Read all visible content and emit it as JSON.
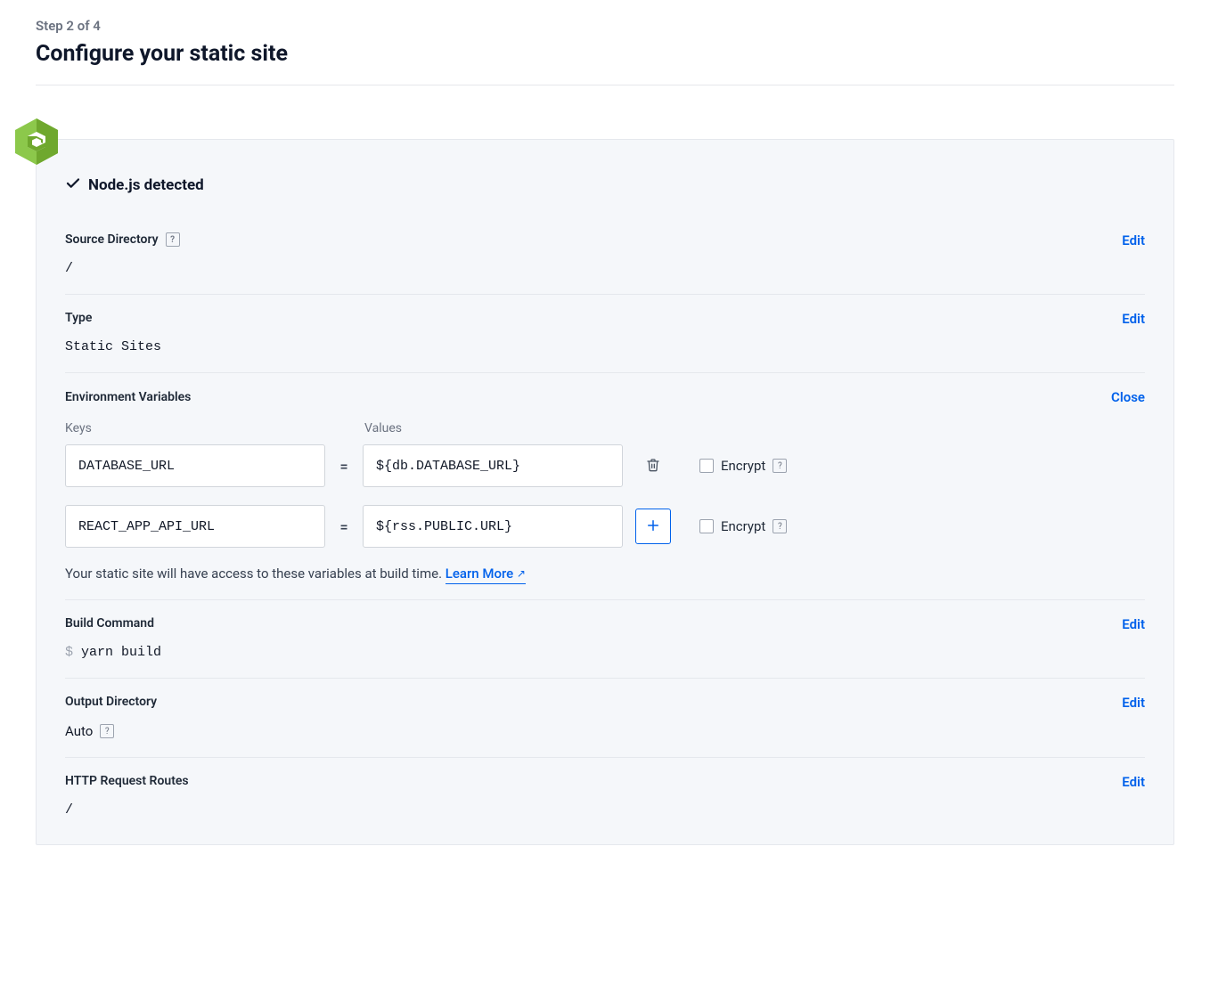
{
  "header": {
    "step_label": "Step 2 of 4",
    "title": "Configure your static site"
  },
  "detected": {
    "label": "Node.js detected"
  },
  "sections": {
    "source_dir": {
      "label": "Source Directory",
      "value": "/",
      "action": "Edit"
    },
    "type": {
      "label": "Type",
      "value": "Static Sites",
      "action": "Edit"
    },
    "env": {
      "label": "Environment Variables",
      "action": "Close",
      "cols": {
        "keys": "Keys",
        "values": "Values"
      },
      "rows": [
        {
          "key": "DATABASE_URL",
          "value": "${db.DATABASE_URL}",
          "encrypt_label": "Encrypt"
        },
        {
          "key": "REACT_APP_API_URL",
          "value": "${rss.PUBLIC.URL}",
          "encrypt_label": "Encrypt"
        }
      ],
      "note_prefix": "Your static site will have access to these variables at build time. ",
      "learn_more": "Learn More"
    },
    "build": {
      "label": "Build Command",
      "value": "yarn build",
      "action": "Edit"
    },
    "output": {
      "label": "Output Directory",
      "value": "Auto",
      "action": "Edit"
    },
    "routes": {
      "label": "HTTP Request Routes",
      "value": "/",
      "action": "Edit"
    }
  },
  "icons": {
    "check": "check-icon",
    "help": "?",
    "trash": "trash-icon",
    "plus": "plus-icon",
    "node": "nodejs-icon",
    "external": "↗"
  }
}
